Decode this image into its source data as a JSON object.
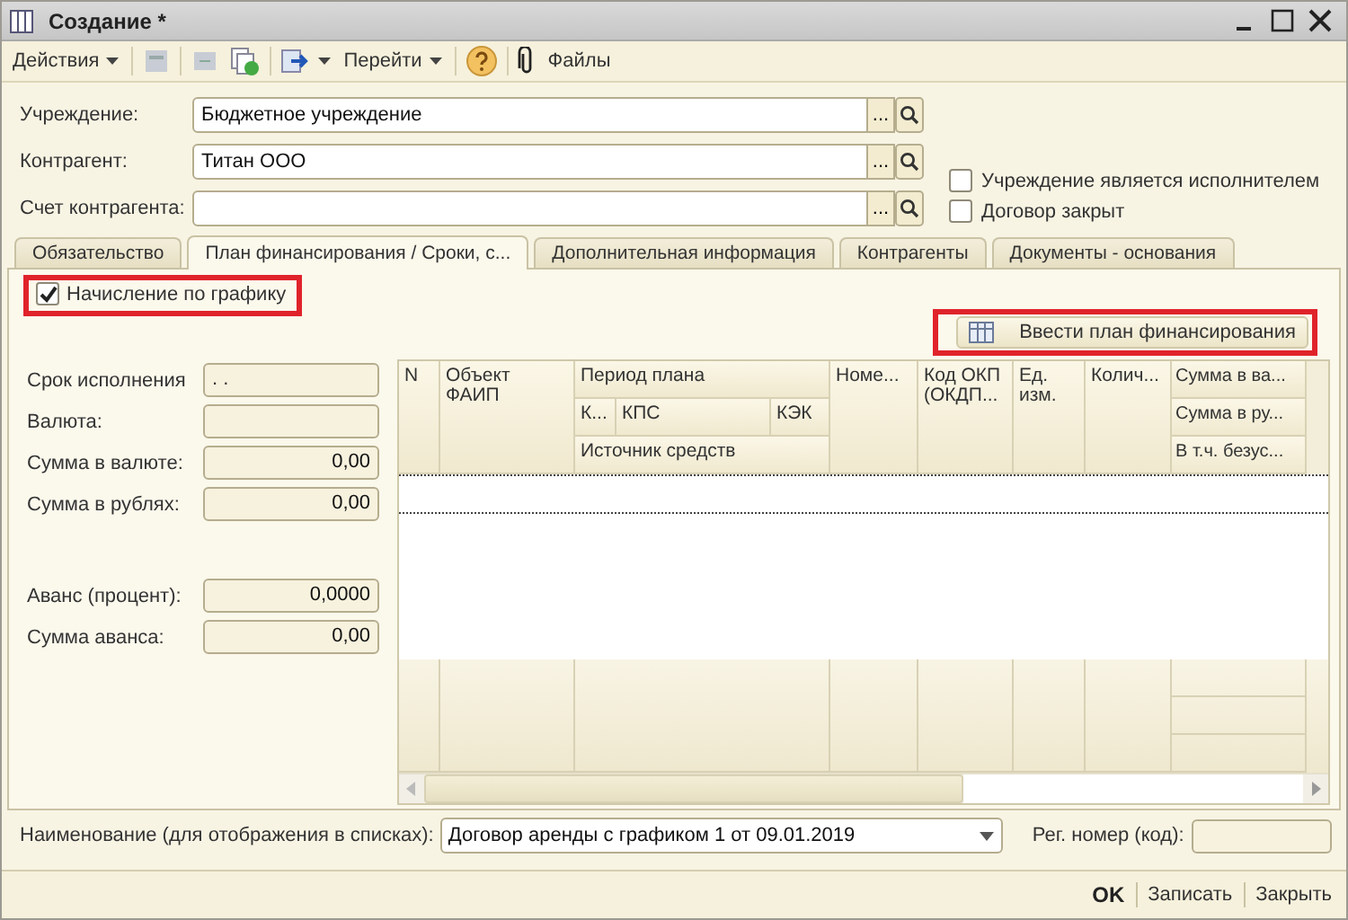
{
  "window": {
    "title": "Создание *"
  },
  "toolbar": {
    "actions_menu": "Действия",
    "goto_menu": "Перейти",
    "files_button": "Файлы"
  },
  "fields": [
    {
      "label": "Учреждение:",
      "value": "Бюджетное учреждение",
      "select_button": "..."
    },
    {
      "label": "Контрагент:",
      "value": "Титан ООО",
      "select_button": "..."
    },
    {
      "label": "Счет контрагента:",
      "select_button": "..."
    }
  ],
  "checkboxes": [
    {
      "label": "Учреждение является исполнителем",
      "checked": false
    },
    {
      "label": "Договор закрыт",
      "checked": false
    }
  ],
  "tabs": [
    {
      "label": "Обязательство",
      "selected": false
    },
    {
      "label": "План финансирования / Сроки, с...",
      "selected": true
    },
    {
      "label": "Дополнительная информация",
      "selected": false
    },
    {
      "label": "Контрагенты",
      "selected": false
    },
    {
      "label": "Документы - основания",
      "selected": false
    }
  ],
  "schedule_checkbox": {
    "label": "Начисление по графику",
    "checked": true
  },
  "plan_button": "Ввести план финансирования",
  "details": [
    {
      "label": "Срок исполнения",
      "value": ". .",
      "kind": "date"
    },
    {
      "label": "Валюта:",
      "kind": "text"
    },
    {
      "label": "Сумма в валюте:",
      "value": "0,00",
      "kind": "number"
    },
    {
      "label": "Сумма в рублях:",
      "value": "0,00",
      "kind": "number"
    },
    {
      "label": "Аванс (процент):",
      "value": "0,0000",
      "kind": "number"
    },
    {
      "label": "Сумма аванса:",
      "value": "0,00",
      "kind": "number"
    }
  ],
  "table": {
    "header": [
      "N",
      "Объект ФАИП",
      "Период плана",
      "Номе...",
      "Код ОКП (ОКДП...",
      "Ед. изм.",
      "Колич...",
      "Сумма в ва...",
      "К...",
      "КПС",
      "КЭК",
      "Сумма в ру...",
      "Источник средств",
      "В т.ч. безус..."
    ]
  },
  "name_field": {
    "label": "Наименование (для отображения в списках):",
    "value": "Договор аренды с графиком 1 от 09.01.2019"
  },
  "reg_field": {
    "label": "Рег. номер (код):"
  },
  "footer_buttons": [
    {
      "label": "OK",
      "kind": "default"
    },
    {
      "label": "Записать",
      "kind": "normal"
    },
    {
      "label": "Закрыть",
      "kind": "normal"
    }
  ]
}
